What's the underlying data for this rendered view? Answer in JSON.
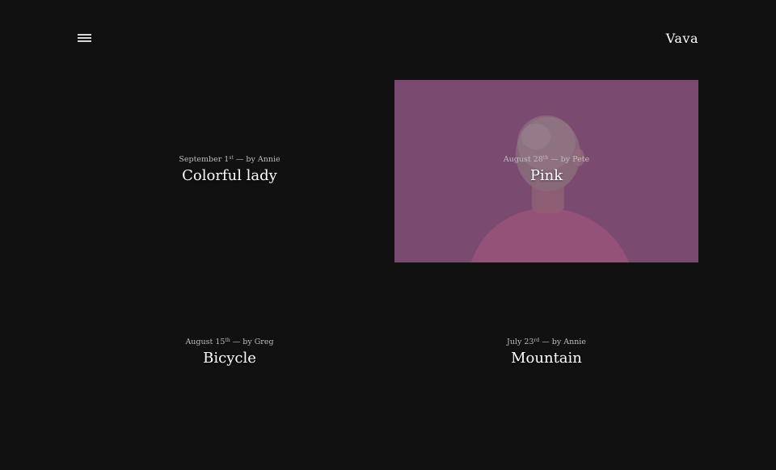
{
  "header": {
    "menu_icon": "hamburger-icon",
    "brand": "Vava"
  },
  "posts": [
    {
      "date": "September 1",
      "date_suffix": "st",
      "byline": " — by Annie",
      "title": "Colorful lady"
    },
    {
      "date": "August 28",
      "date_suffix": "th",
      "byline": " — by Pete",
      "title": "Pink",
      "image_tint": "#7b4a70"
    },
    {
      "date": "August 15",
      "date_suffix": "th",
      "byline": " — by Greg",
      "title": "Bicycle"
    },
    {
      "date": "July 23",
      "date_suffix": "rd",
      "byline": " — by Annie",
      "title": "Mountain"
    }
  ],
  "colors": {
    "background": "#111111",
    "text": "#ffffff",
    "meta": "#bdbdbd",
    "pink_overlay": "#7b4a70"
  }
}
